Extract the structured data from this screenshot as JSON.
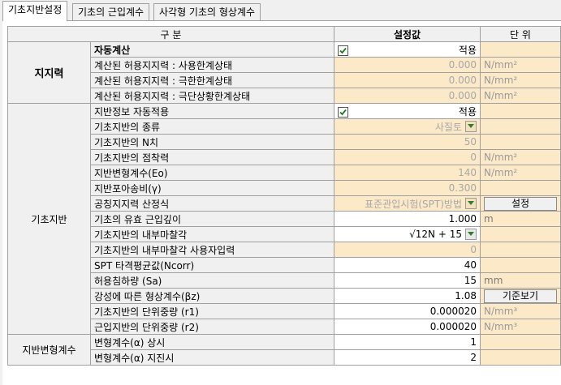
{
  "tabs": [
    "기초지반설정",
    "기초의 근입계수",
    "사각형 기초의 형상계수"
  ],
  "header": {
    "category": "구     분",
    "value": "설정값",
    "unit": "단  위"
  },
  "groups": {
    "bearing": "지지력",
    "foundation": "기초지반",
    "deform": "지반변형계수"
  },
  "rows": {
    "auto_calc": {
      "label": "자동계산",
      "text": "적용",
      "checked": true
    },
    "bearing_service": {
      "label": "계산된 허용지지력 : 사용한계상태",
      "value": "0.000",
      "unit": "N/mm²"
    },
    "bearing_ultimate": {
      "label": "계산된 허용지지력 : 극한한계상태",
      "value": "0.000",
      "unit": "N/mm²"
    },
    "bearing_extreme": {
      "label": "계산된 허용지지력 : 극단상황한계상태",
      "value": "0.000",
      "unit": "N/mm²"
    },
    "ground_auto": {
      "label": "지반정보 자동적용",
      "text": "적용",
      "checked": true
    },
    "soil_type": {
      "label": "기초지반의 종류",
      "value": "사질토"
    },
    "n_value": {
      "label": "기초지반의 N치",
      "value": "50"
    },
    "cohesion": {
      "label": "기초지반의 점착력",
      "value": "0",
      "unit": "N/mm²"
    },
    "eo": {
      "label": "지반변형계수(Eo)",
      "value": "140",
      "unit": "N/mm²"
    },
    "poisson": {
      "label": "지반포아송비(γ)",
      "value": "0.300"
    },
    "method": {
      "label": "공칭지지력 산정식",
      "value": "표준관입시험(SPT)방법",
      "button": "설정"
    },
    "depth": {
      "label": "기초의 유효 근입깊이",
      "value": "1.000",
      "unit": "m"
    },
    "friction": {
      "label": "기초지반의 내부마찰각",
      "value": "√12N + 15"
    },
    "friction_user": {
      "label": "기초지반의 내부마찰각 사용자입력",
      "value": "0"
    },
    "ncorr": {
      "label": "SPT 타격평균값(Ncorr)",
      "value": "40"
    },
    "sa": {
      "label": "허용침하량 (Sa)",
      "value": "15",
      "unit": "mm"
    },
    "bz": {
      "label": "강성에 따른 형상계수(βz)",
      "value": "1.08",
      "button": "기준보기"
    },
    "r1": {
      "label": "기초지반의 단위중량 (r1)",
      "value": "0.000020",
      "unit": "N/mm³"
    },
    "r2": {
      "label": "근입지반의 단위중량 (r2)",
      "value": "0.000020",
      "unit": "N/mm³"
    },
    "alpha_normal": {
      "label": "변형계수(α) 상시",
      "value": "1"
    },
    "alpha_quake": {
      "label": "변형계수(α) 지진시",
      "value": "2"
    }
  }
}
